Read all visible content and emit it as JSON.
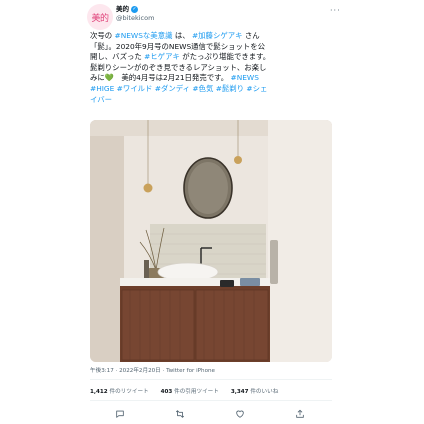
{
  "author": {
    "avatar_text": "美的",
    "name": "美的",
    "handle": "@bitekicom"
  },
  "tweet": {
    "line1_a": "次号の ",
    "line1_tag1": "#NEWSな美意識",
    "line1_b": " は、 ",
    "line1_tag2": "#加藤シゲアキ",
    "line1_c": " さん",
    "line2": "「髭」。2020年9月号のNEWS通信で髭ショットを公",
    "line3_a": "開し、バズった ",
    "line3_tag": "#ヒゲアキ",
    "line3_b": " がたっぷり堪能できます。",
    "line4": "髭剃りシーンがのぞき見できるレアショット、お楽し",
    "line5_a": "みに",
    "line5_heart": "💚",
    "line5_b": "　美的4月号は2月21日発売です。",
    "line5_tag": " #NEWS",
    "line6": "#HIGE #ワイルド #ダンディ #色気 #髭剃り #シェ",
    "line7": "イバー"
  },
  "meta": {
    "timestamp": "午後3:17 · 2022年2月20日 · Twitter for iPhone"
  },
  "stats": {
    "retweets_count": "1,412",
    "retweets_label": " 件のリツイート",
    "quotes_count": "403",
    "quotes_label": " 件の引用ツイート",
    "likes_count": "3,347",
    "likes_label": " 件のいいね"
  },
  "icons": {
    "reply": "reply-icon",
    "retweet": "retweet-icon",
    "like": "heart-icon",
    "share": "share-icon",
    "more": "more-icon"
  },
  "colors": {
    "link": "#1d9bf0",
    "text": "#0f1419",
    "secondary": "#536471",
    "brand": "#e0457b"
  }
}
